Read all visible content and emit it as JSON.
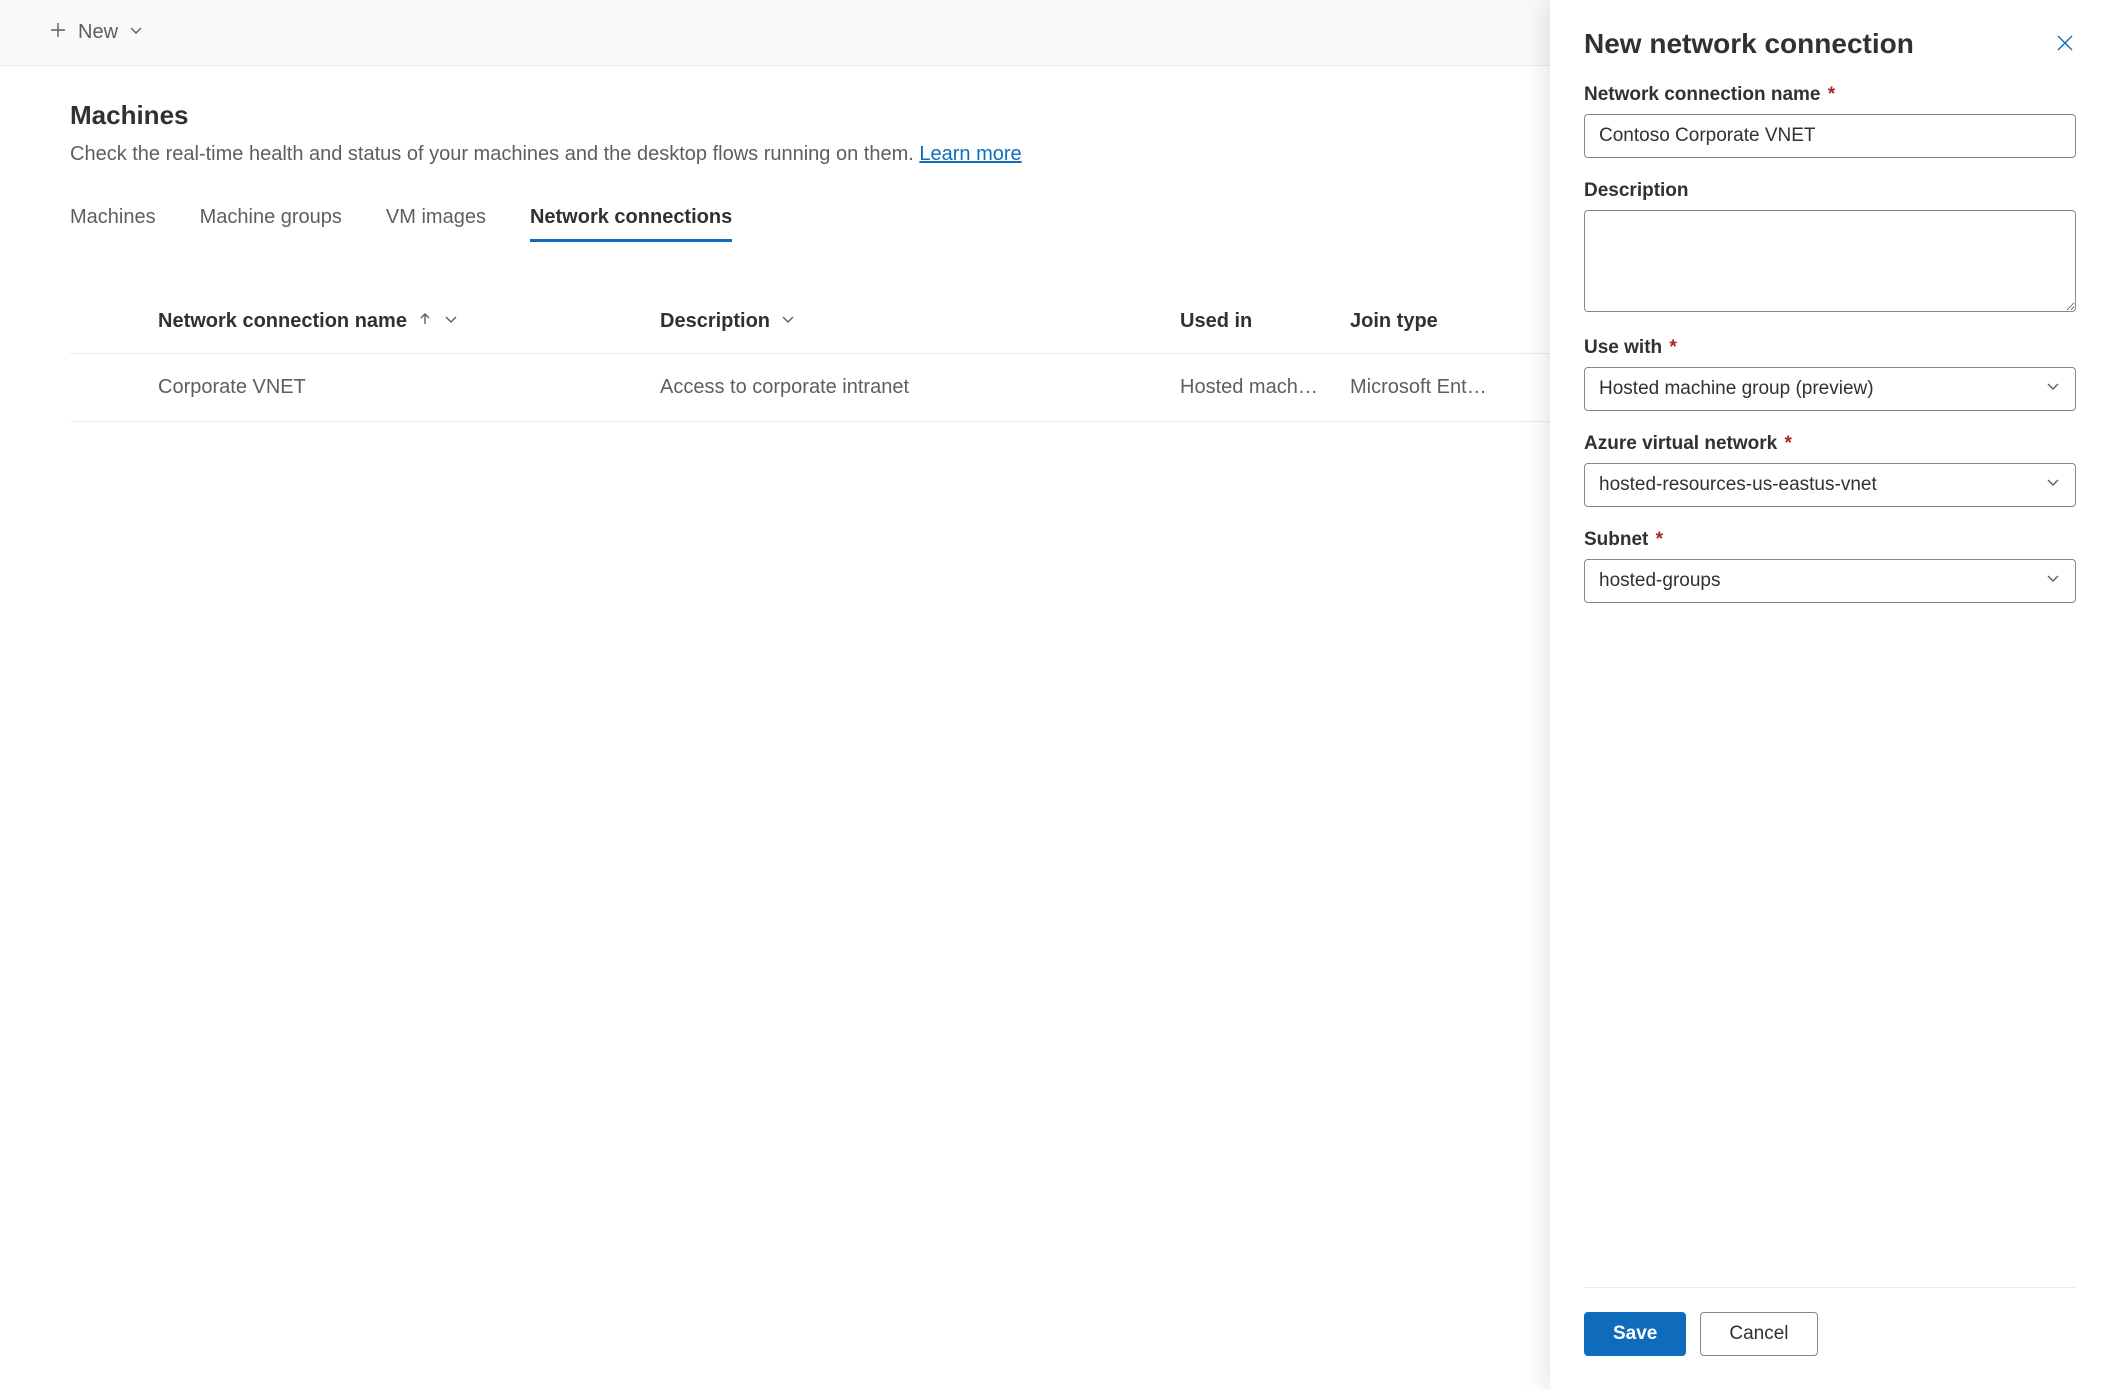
{
  "topbar": {
    "new_label": "New"
  },
  "head": {
    "title": "Machines",
    "subtitle_pre": "Check the real-time health and status of your machines and the desktop flows running on them. ",
    "learn_more": "Learn more"
  },
  "tabs": {
    "machines": "Machines",
    "groups": "Machine groups",
    "images": "VM images",
    "network": "Network connections"
  },
  "columns": {
    "name": "Network connection name",
    "desc": "Description",
    "used": "Used in",
    "join": "Join type"
  },
  "rows": [
    {
      "name": "Corporate VNET",
      "desc": "Access to corporate intranet",
      "used": "Hosted mach…",
      "join": "Microsoft Ent…"
    }
  ],
  "panel": {
    "title": "New network connection",
    "labels": {
      "name": "Network connection name",
      "desc": "Description",
      "use_with": "Use with",
      "avnet": "Azure virtual network",
      "subnet": "Subnet"
    },
    "values": {
      "name": "Contoso Corporate VNET",
      "desc": "",
      "use_with": "Hosted machine group (preview)",
      "avnet": "hosted-resources-us-eastus-vnet",
      "subnet": "hosted-groups"
    },
    "buttons": {
      "save": "Save",
      "cancel": "Cancel"
    }
  }
}
